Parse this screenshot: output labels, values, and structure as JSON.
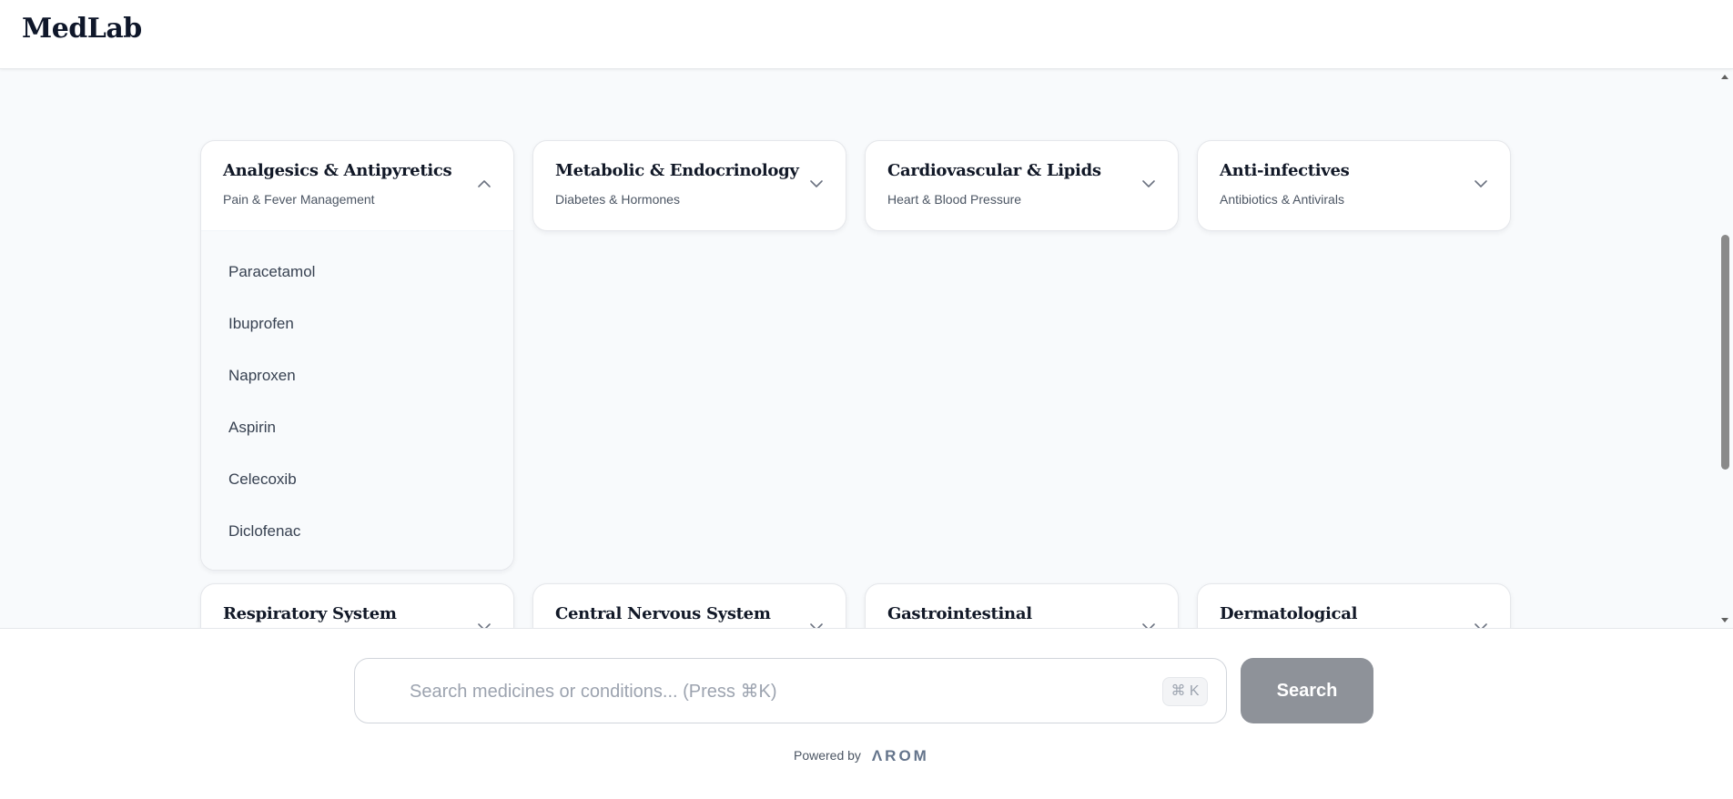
{
  "header": {
    "brand": "MedLab"
  },
  "categories": [
    {
      "title": "Analgesics & Antipyretics",
      "subtitle": "Pain & Fever Management",
      "expanded": true,
      "items": [
        "Paracetamol",
        "Ibuprofen",
        "Naproxen",
        "Aspirin",
        "Celecoxib",
        "Diclofenac"
      ]
    },
    {
      "title": "Metabolic & Endocrinology",
      "subtitle": "Diabetes & Hormones",
      "expanded": false
    },
    {
      "title": "Cardiovascular & Lipids",
      "subtitle": "Heart & Blood Pressure",
      "expanded": false
    },
    {
      "title": "Anti-infectives",
      "subtitle": "Antibiotics & Antivirals",
      "expanded": false
    },
    {
      "title": "Respiratory System",
      "subtitle": "",
      "expanded": false
    },
    {
      "title": "Central Nervous System",
      "subtitle": "",
      "expanded": false
    },
    {
      "title": "Gastrointestinal",
      "subtitle": "",
      "expanded": false
    },
    {
      "title": "Dermatological",
      "subtitle": "",
      "expanded": false
    }
  ],
  "search": {
    "placeholder": "Search medicines or conditions... (Press ⌘K)",
    "value": "",
    "shortcut": "⌘ K",
    "button_label": "Search"
  },
  "footer": {
    "powered_by": "Powered by",
    "logo_text": "ΛROM"
  },
  "colors": {
    "accent": "#8e9299",
    "background": "#f8fafc",
    "text": "#111827"
  }
}
